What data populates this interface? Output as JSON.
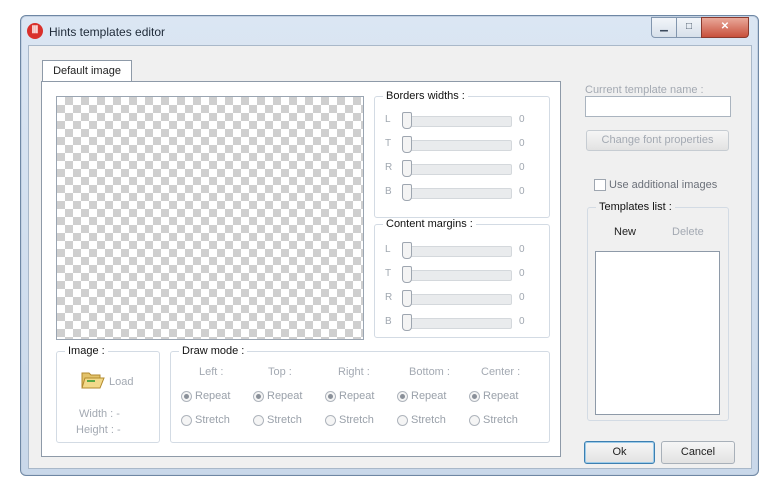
{
  "window": {
    "title": "Hints templates editor",
    "icon": "app-icon"
  },
  "tabs": [
    {
      "label": "Default image"
    }
  ],
  "borders": {
    "title": "Borders widths :",
    "rows": [
      {
        "label": "L",
        "value": "0"
      },
      {
        "label": "T",
        "value": "0"
      },
      {
        "label": "R",
        "value": "0"
      },
      {
        "label": "B",
        "value": "0"
      }
    ]
  },
  "margins": {
    "title": "Content margins :",
    "rows": [
      {
        "label": "L",
        "value": "0"
      },
      {
        "label": "T",
        "value": "0"
      },
      {
        "label": "R",
        "value": "0"
      },
      {
        "label": "B",
        "value": "0"
      }
    ]
  },
  "image": {
    "title": "Image :",
    "load_label": "Load",
    "width_label": "Width :",
    "width_value": "-",
    "height_label": "Height :",
    "height_value": "-"
  },
  "draw_mode": {
    "title": "Draw mode :",
    "columns": [
      {
        "label": "Left :",
        "repeat": "Repeat",
        "stretch": "Stretch",
        "selected": "Repeat"
      },
      {
        "label": "Top :",
        "repeat": "Repeat",
        "stretch": "Stretch",
        "selected": "Repeat"
      },
      {
        "label": "Right :",
        "repeat": "Repeat",
        "stretch": "Stretch",
        "selected": "Repeat"
      },
      {
        "label": "Bottom :",
        "repeat": "Repeat",
        "stretch": "Stretch",
        "selected": "Repeat"
      },
      {
        "label": "Center :",
        "repeat": "Repeat",
        "stretch": "Stretch",
        "selected": "Repeat"
      }
    ]
  },
  "template": {
    "name_label": "Current template name :",
    "name_value": "",
    "font_button": "Change font properties",
    "use_additional": "Use additional images",
    "use_additional_checked": false
  },
  "templates_list": {
    "title": "Templates list :",
    "new_label": "New",
    "delete_label": "Delete",
    "items": []
  },
  "footer": {
    "ok_label": "Ok",
    "cancel_label": "Cancel"
  },
  "colors": {
    "accent": "#3c7fb1",
    "titlebar": "#c9d8ea",
    "close": "#c8503c"
  }
}
